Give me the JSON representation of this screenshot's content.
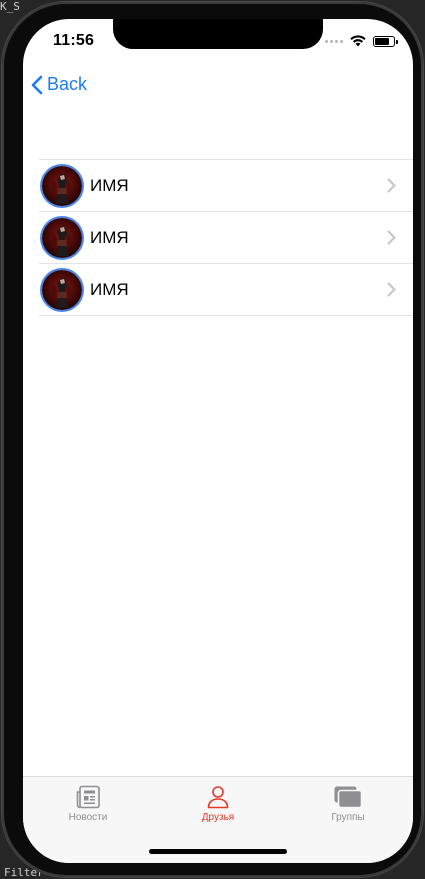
{
  "status_bar": {
    "time": "11:56",
    "battery_level": 0.85
  },
  "nav": {
    "back_label": "Back",
    "back_icon": "chevron-left-icon",
    "accent_color": "#1a7cf5"
  },
  "friends": [
    {
      "name": "ИМЯ",
      "avatar_icon": "friend-avatar",
      "accessory_icon": "chevron-right-icon"
    },
    {
      "name": "ИМЯ",
      "avatar_icon": "friend-avatar",
      "accessory_icon": "chevron-right-icon"
    },
    {
      "name": "ИМЯ",
      "avatar_icon": "friend-avatar",
      "accessory_icon": "chevron-right-icon"
    }
  ],
  "tab_bar": {
    "selected_color": "#e5392a",
    "unselected_color": "#8e8e93",
    "tabs": [
      {
        "label": "Новости",
        "icon": "newspaper-icon",
        "selected": false
      },
      {
        "label": "Друзья",
        "icon": "person-icon",
        "selected": true
      },
      {
        "label": "Группы",
        "icon": "stacked-rectangles-icon",
        "selected": false
      }
    ]
  },
  "backdrop": {
    "top_text": "K_S",
    "bottom_text": "Filter"
  }
}
